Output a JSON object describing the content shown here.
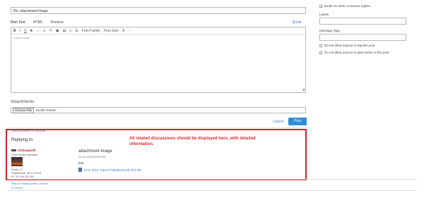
{
  "subject": {
    "value": "Re: attachment image"
  },
  "tabs": {
    "rich": "Rich Text",
    "html": "HTML",
    "preview": "Preview",
    "quote": "Quote"
  },
  "toolbar": {
    "bold": "B",
    "italic": "I",
    "underline": "U",
    "strike": "S",
    "smiley": "☺",
    "link": "∞",
    "font_family": "Font Family",
    "font_size": "Font Size",
    "color": "A"
  },
  "editor": {
    "placeholder": "Enter a body"
  },
  "attachments": {
    "label": "Attachments",
    "choose_button": "Choose File",
    "no_file": "No file chosen"
  },
  "actions": {
    "cancel": "Cancel",
    "post": "Post"
  },
  "right": {
    "email_me": "Email me when someone replies",
    "labels_label": "Labels",
    "message_tags_label": "Message Tags",
    "no_tag": "Do not allow anyone to tag this post",
    "no_kudos": "Do not allow anyone to give kudos to this post"
  },
  "annotation": {
    "note": "All related discussions should be displayed here, with detailed information."
  },
  "reply": {
    "view_popup": "View discussion in a popup",
    "replying_to": "Replying to:",
    "author": "Vishwajeeth",
    "role": "Community Manager",
    "posts": "Posts: 17",
    "registered": "Registered: 08-12-2015",
    "ip": "IP: 10.244.212.36",
    "title": "attachment image",
    "date": "09-01-2015 04:00 PM",
    "text": "test",
    "attachment": "KCS 2015 -Open PulseBook.pdf 634 KB",
    "report": "Report Inappropriate Content",
    "views": "(0 Views)"
  },
  "colors": {
    "accent": "#2f8ed8",
    "highlight": "#d0202a"
  }
}
